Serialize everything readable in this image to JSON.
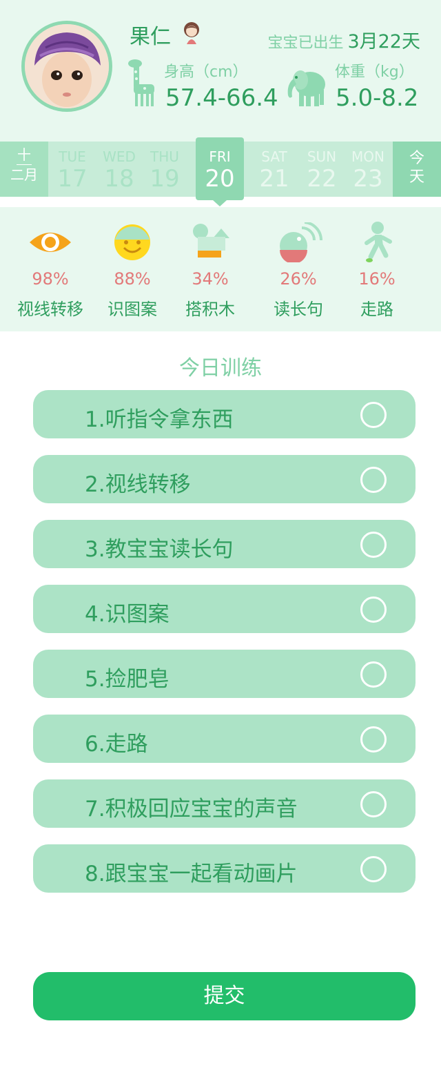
{
  "header": {
    "name": "果仁",
    "born_label": "宝宝已出生",
    "born_days": "3月22天",
    "height_label": "身高（cm）",
    "height_value": "57.4-66.4",
    "weight_label": "体重（kg）",
    "weight_value": "5.0-8.2"
  },
  "calendar": {
    "month": "十二月",
    "month_top": "十",
    "month_bottom": "二月",
    "today_button_top": "今",
    "today_button_bottom": "天",
    "days": [
      {
        "weekday": "TUE",
        "date": "17"
      },
      {
        "weekday": "WED",
        "date": "18"
      },
      {
        "weekday": "THU",
        "date": "19"
      },
      {
        "weekday": "FRI",
        "date": "20",
        "selected": true
      },
      {
        "weekday": "SAT",
        "date": "21"
      },
      {
        "weekday": "SUN",
        "date": "22"
      },
      {
        "weekday": "MON",
        "date": "23"
      }
    ]
  },
  "stats": [
    {
      "icon": "eye-icon",
      "percent": "98%",
      "label": "视线转移"
    },
    {
      "icon": "smiley-icon",
      "percent": "88%",
      "label": "识图案"
    },
    {
      "icon": "blocks-icon",
      "percent": "34%",
      "label": "搭积木"
    },
    {
      "icon": "speaking-icon",
      "percent": "26%",
      "label": "读长句"
    },
    {
      "icon": "walking-icon",
      "percent": "16%",
      "label": "走路"
    }
  ],
  "training": {
    "title": "今日训练",
    "tasks": [
      "1.听指令拿东西",
      "2.视线转移",
      "3.教宝宝读长句",
      "4.识图案",
      "5.捡肥皂",
      "6.走路",
      "7.积极回应宝宝的声音",
      "8.跟宝宝一起看动画片"
    ]
  },
  "submit_label": "提交",
  "colors": {
    "primary_green": "#2f9e5e",
    "light_green": "#ace3c6",
    "header_bg": "#e8f8ef",
    "accent_green": "#22bd6a",
    "percent_red": "#e27979"
  }
}
